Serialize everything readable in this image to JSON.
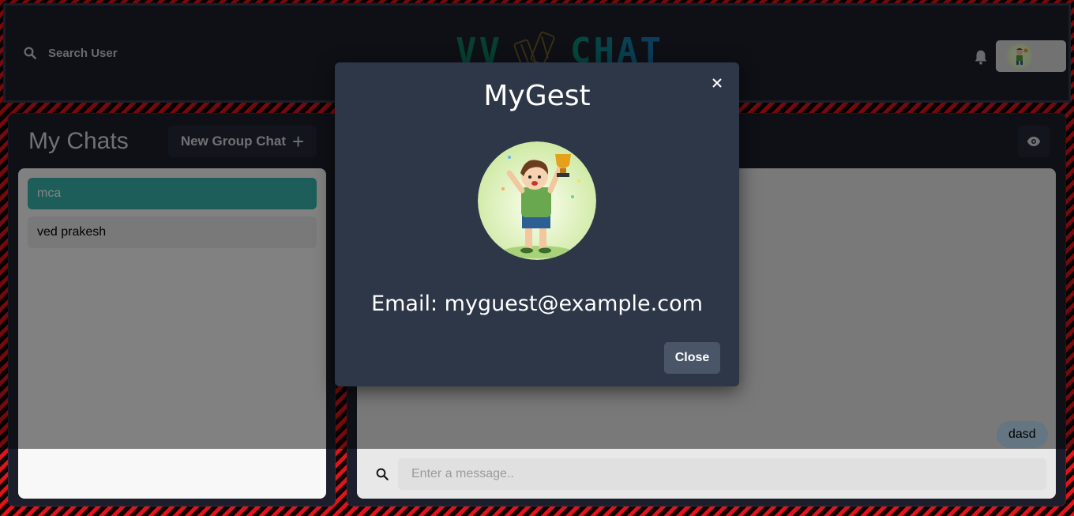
{
  "header": {
    "search_label": "Search User",
    "logo_left": "VV",
    "logo_right": "CHAT",
    "icons": {
      "search": "search-icon",
      "bell": "bell-icon",
      "avatar": "user-avatar"
    }
  },
  "chats_panel": {
    "title": "My Chats",
    "new_group_label": "New Group Chat",
    "new_group_icon": "+",
    "items": [
      {
        "label": "mca",
        "active": true
      },
      {
        "label": "ved prakesh",
        "active": false
      }
    ]
  },
  "chatbox": {
    "message": "dasd",
    "input_placeholder": "Enter a message..",
    "icons": {
      "eye": "eye-icon",
      "search": "search-icon"
    }
  },
  "modal": {
    "title": "MyGest",
    "email": "Email: myguest@example.com",
    "close_label": "Close"
  },
  "colors": {
    "accent_teal": "#38b2ac",
    "modal_bg": "#2d3748",
    "header_bg": "#1c1f2b",
    "bubble": "#bee3f8"
  }
}
